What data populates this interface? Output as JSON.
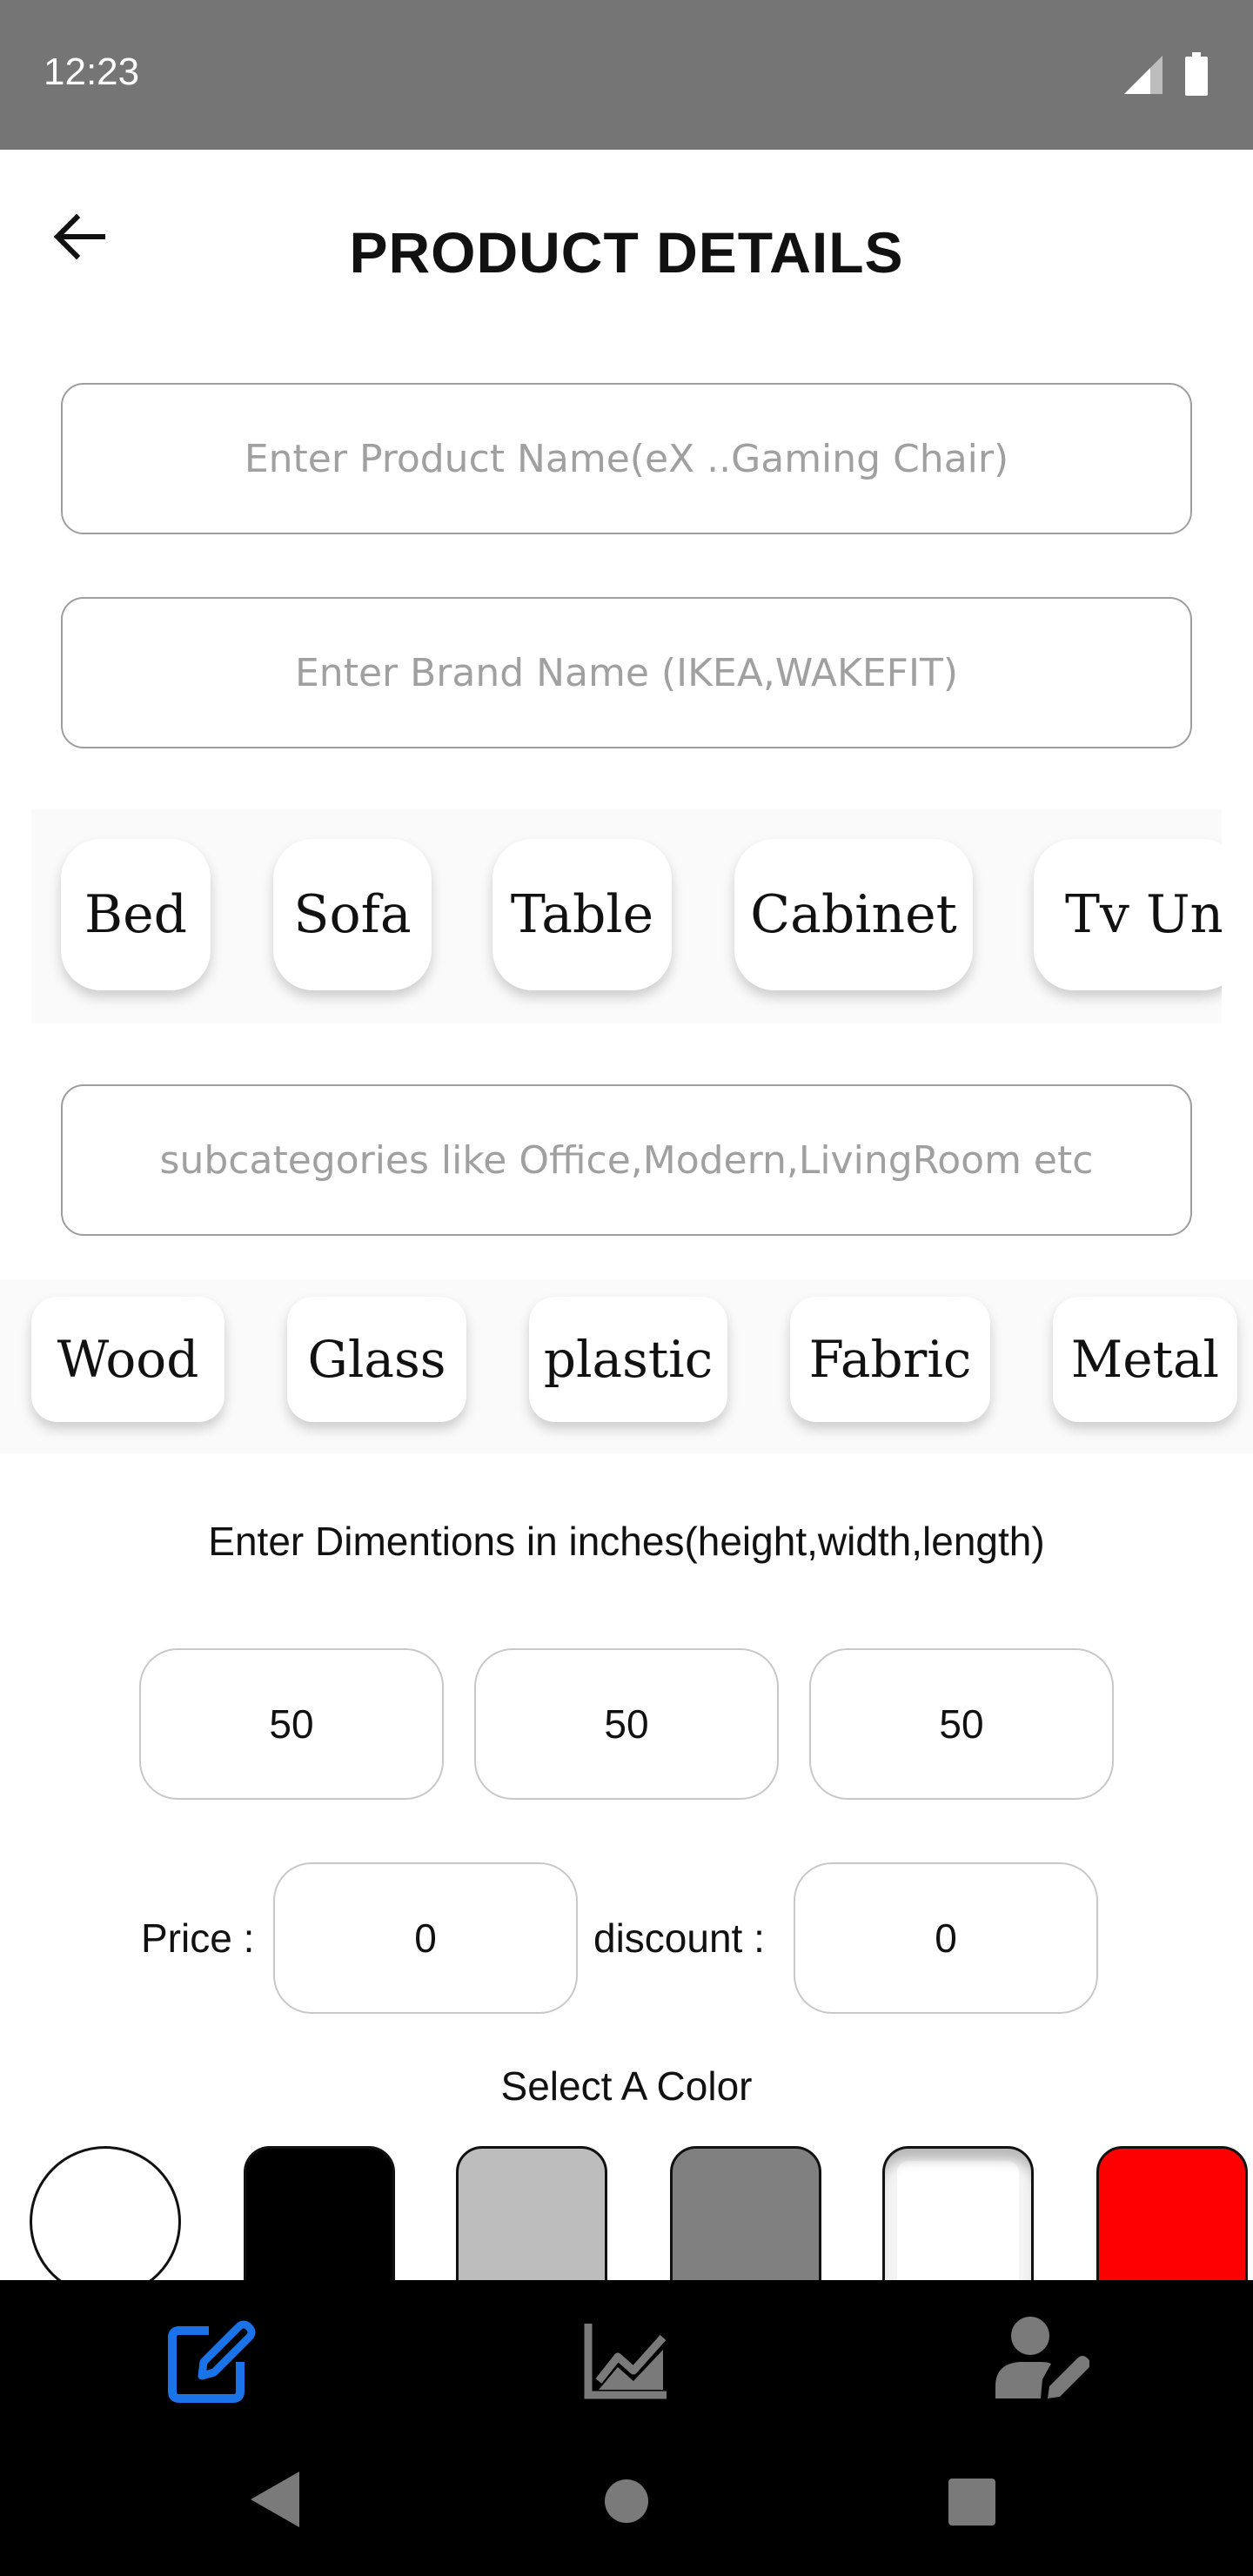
{
  "status_bar": {
    "time": "12:23"
  },
  "header": {
    "title": "PRODUCT DETAILS"
  },
  "form": {
    "product_name_placeholder": "Enter Product Name(eX ..Gaming Chair)",
    "brand_name_placeholder": "Enter Brand Name (IKEA,WAKEFIT)",
    "subcategory_placeholder": "subcategories like Office,Modern,LivingRoom etc"
  },
  "categories": [
    "Bed",
    "Sofa",
    "Table",
    "Cabinet",
    "Tv Unit"
  ],
  "materials": [
    "Wood",
    "Glass",
    "plastic",
    "Fabric",
    "Metal"
  ],
  "dimensions": {
    "label": "Enter Dimentions in inches(height,width,length)",
    "height": "50",
    "width": "50",
    "length": "50"
  },
  "pricing": {
    "price_label": "Price :",
    "price_value": "0",
    "discount_label": "discount :",
    "discount_value": "0"
  },
  "colors": {
    "label": "Select A Color",
    "swatches": [
      "#ffffff",
      "#000000",
      "#bdbdbd",
      "#808080",
      "#ffffff",
      "#ff0000"
    ]
  },
  "bottom_nav": {
    "active_color": "#1a73e8",
    "inactive_color": "#7a7a7a",
    "items": [
      "edit-icon",
      "chart-icon",
      "user-edit-icon"
    ]
  }
}
